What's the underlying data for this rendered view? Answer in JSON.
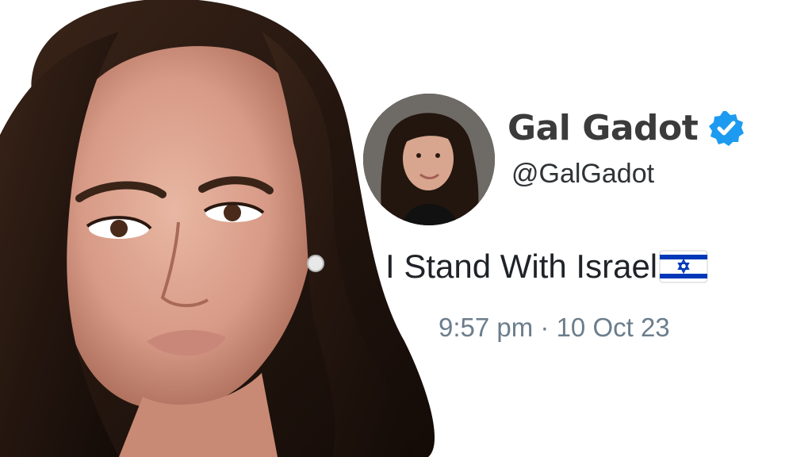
{
  "tweet": {
    "display_name": "Gal Gadot",
    "handle": "@GalGadot",
    "text": "I Stand With Israel",
    "timestamp": "9:57 pm · 10 Oct 23",
    "verified": true,
    "flag_icon": "israel-flag-icon",
    "avatar_icon": "profile-avatar"
  },
  "colors": {
    "verified_badge": "#1d9bf0",
    "timestamp": "#6b7d8c",
    "flag_blue": "#0038b8"
  }
}
